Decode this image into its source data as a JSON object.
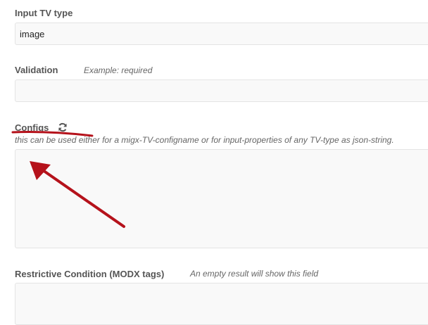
{
  "fields": {
    "input_tv_type": {
      "label": "Input TV type",
      "value": "image"
    },
    "validation": {
      "label": "Validation",
      "hint": "Example: required",
      "value": ""
    },
    "configs": {
      "label": "Configs",
      "hint": "this can be used either for a migx-TV-configname or for input-properties of any TV-type as json-string.",
      "value": ""
    },
    "restrictive_condition": {
      "label": "Restrictive Condition (MODX tags)",
      "hint": "An empty result will show this field",
      "value": ""
    }
  },
  "icons": {
    "refresh": "refresh-icon"
  },
  "annotation": {
    "color": "#b5121b"
  }
}
